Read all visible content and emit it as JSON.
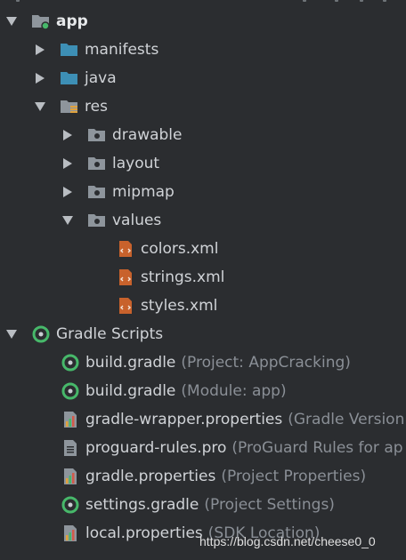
{
  "tree": {
    "app": "app",
    "manifests": "manifests",
    "java": "java",
    "res": "res",
    "drawable": "drawable",
    "layout": "layout",
    "mipmap": "mipmap",
    "values": "values",
    "colors": "colors.xml",
    "strings": "strings.xml",
    "styles": "styles.xml",
    "gradle_scripts": "Gradle Scripts",
    "gradle_items": [
      {
        "name": "build.gradle",
        "hint": "(Project: AppCracking)",
        "icon": "gradle-icon"
      },
      {
        "name": "build.gradle",
        "hint": "(Module: app)",
        "icon": "gradle-icon"
      },
      {
        "name": "gradle-wrapper.properties",
        "hint": "(Gradle Version",
        "icon": "properties-icon"
      },
      {
        "name": "proguard-rules.pro",
        "hint": "(ProGuard Rules for ap",
        "icon": "text-file-icon"
      },
      {
        "name": "gradle.properties",
        "hint": "(Project Properties)",
        "icon": "properties-icon"
      },
      {
        "name": "settings.gradle",
        "hint": "(Project Settings)",
        "icon": "gradle-icon"
      },
      {
        "name": "local.properties",
        "hint": "(SDK Location)",
        "icon": "properties-icon"
      }
    ]
  },
  "watermark": "https://blog.csdn.net/cheese0_0",
  "colors": {
    "background": "#2b2d30",
    "folder_blue": "#3d8fb5",
    "gradle_green": "#47b86a",
    "xml_orange": "#c8622c"
  }
}
